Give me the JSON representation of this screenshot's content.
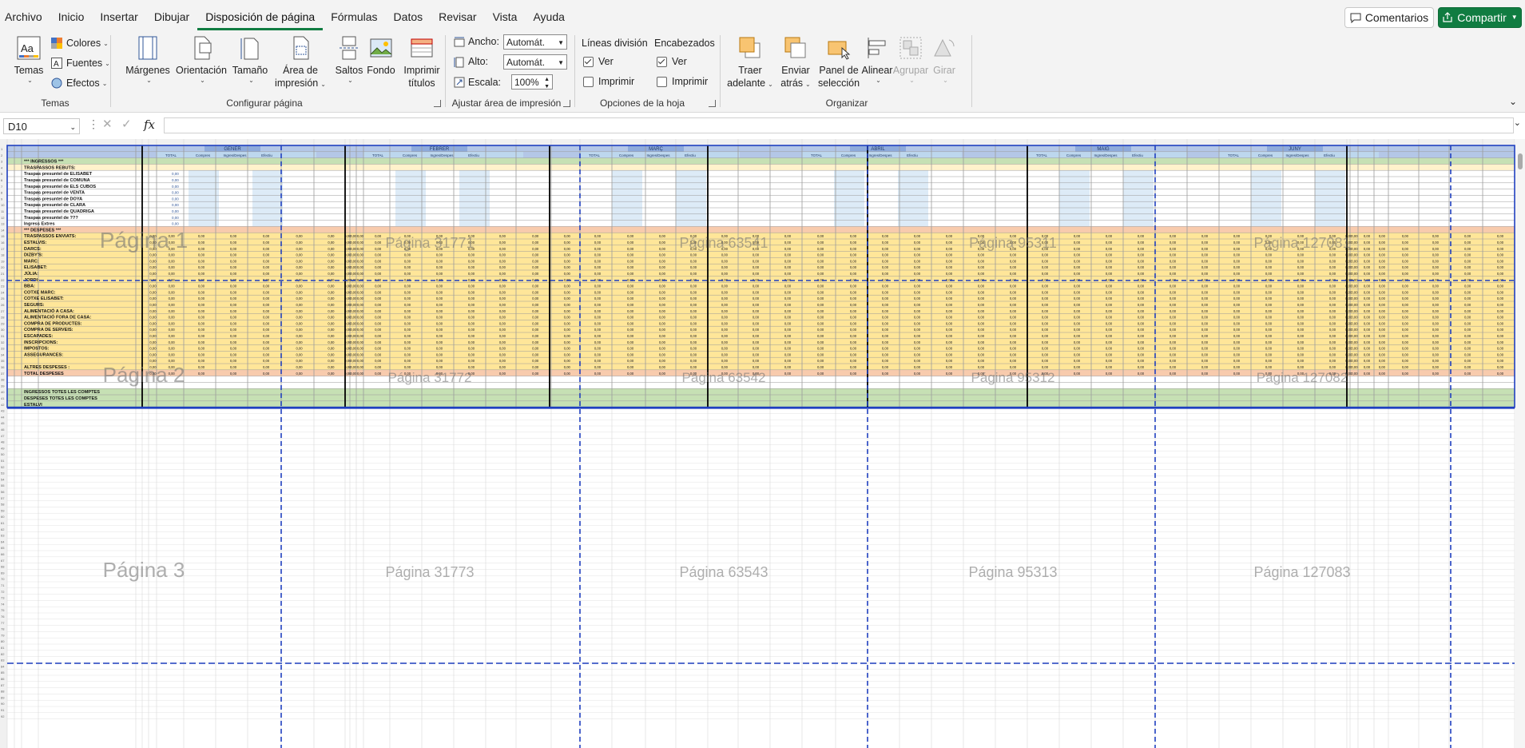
{
  "menu": {
    "tabs": [
      "Archivo",
      "Inicio",
      "Insertar",
      "Dibujar",
      "Disposición de página",
      "Fórmulas",
      "Datos",
      "Revisar",
      "Vista",
      "Ayuda"
    ],
    "active_tab": "Disposición de página",
    "comments_label": "Comentarios",
    "share_label": "Compartir"
  },
  "ribbon": {
    "temas": {
      "group_label": "Temas",
      "temas_label": "Temas",
      "colores_label": "Colores",
      "fuentes_label": "Fuentes",
      "efectos_label": "Efectos"
    },
    "configurar": {
      "group_label": "Configurar página",
      "margenes_label": "Márgenes",
      "orientacion_label": "Orientación",
      "tamano_label": "Tamaño",
      "area_label_1": "Área de",
      "area_label_2": "impresión",
      "saltos_label": "Saltos",
      "fondo_label": "Fondo",
      "imprimir_label_1": "Imprimir",
      "imprimir_label_2": "títulos"
    },
    "ajustar": {
      "group_label": "Ajustar área de impresión",
      "ancho_label": "Ancho:",
      "ancho_value": "Automát.",
      "alto_label": "Alto:",
      "alto_value": "Automát.",
      "escala_label": "Escala:",
      "escala_value": "100%"
    },
    "opciones": {
      "group_label": "Opciones de la hoja",
      "lineas_label": "Líneas división",
      "encabezados_label": "Encabezados",
      "ver_label": "Ver",
      "imprimir_label": "Imprimir",
      "lineas_ver": true,
      "lineas_imprimir": false,
      "enc_ver": true,
      "enc_imprimir": false
    },
    "organizar": {
      "group_label": "Organizar",
      "traer_1": "Traer",
      "traer_2": "adelante",
      "enviar_1": "Enviar",
      "enviar_2": "atrás",
      "panel_1": "Panel de",
      "panel_2": "selección",
      "alinear_label": "Alinear",
      "agrupar_label": "Agrupar",
      "girar_label": "Girar"
    }
  },
  "formula_bar": {
    "name_box": "D10",
    "formula": ""
  },
  "sheet": {
    "page_watermarks": [
      "Página 1",
      "Página 31771",
      "Página 63541",
      "Página 95311",
      "Página 127081",
      "Página 2",
      "Página 31772",
      "Página 63542",
      "Página 95312",
      "Página 127082",
      "Página 3",
      "Página 31773",
      "Página 63543",
      "Página 95313",
      "Página 127083"
    ],
    "row_labels": [
      "*** INGRESSOS ***",
      "TRASPASSOS REBUTS:",
      "Traspas presuntel de ELISABET",
      "Traspas presuntel de COMUNA",
      "Traspas presuntel de ELS CUBOS",
      "Traspas presuntel de VENTA",
      "Traspas presuntel de DOYA",
      "Traspas presuntel de CLARA",
      "Traspas presuntel de QUADRIGA",
      "Traspas presuntel de ???",
      "Ingress Extres",
      "*** DESPESES ***",
      "TRASPASSOS ENVIATS:",
      "ESTALVIS:",
      "DARCS:",
      "DIZBY'S:",
      "MARC:",
      "ELISABET:",
      "JÚLIA:",
      "JORDI:",
      "BBA:",
      "COTXE MARC:",
      "COTXE ELISABET:",
      "SEGURS:",
      "ALIMENTACIÓ A CASA:",
      "ALIMENTACIÓ FORA DE CASA:",
      "COMPRA DE PRODUCTES:",
      "COMPRA DE SERVEIS:",
      "ESCAPADES:",
      "INSCRIPCIONS:",
      "IMPOSTOS:",
      "ASSEGURANCES:",
      "",
      "ALTRES DESPESES :",
      "TOTAL DESPESES",
      "",
      "",
      "INGRESSOS TOTES LES COMPTES",
      "DESPESES TOTES LES COMPTES",
      "ESTALVI"
    ],
    "month_headers": [
      "GENER",
      "FEBRER",
      "MARÇ",
      "ABRIL",
      "MAIG",
      "JUNY",
      "JULIOL",
      "AGOST"
    ],
    "sub_headers": [
      "TOTAL",
      "Compres",
      "Ingres/Despes",
      "Efectiu"
    ]
  }
}
